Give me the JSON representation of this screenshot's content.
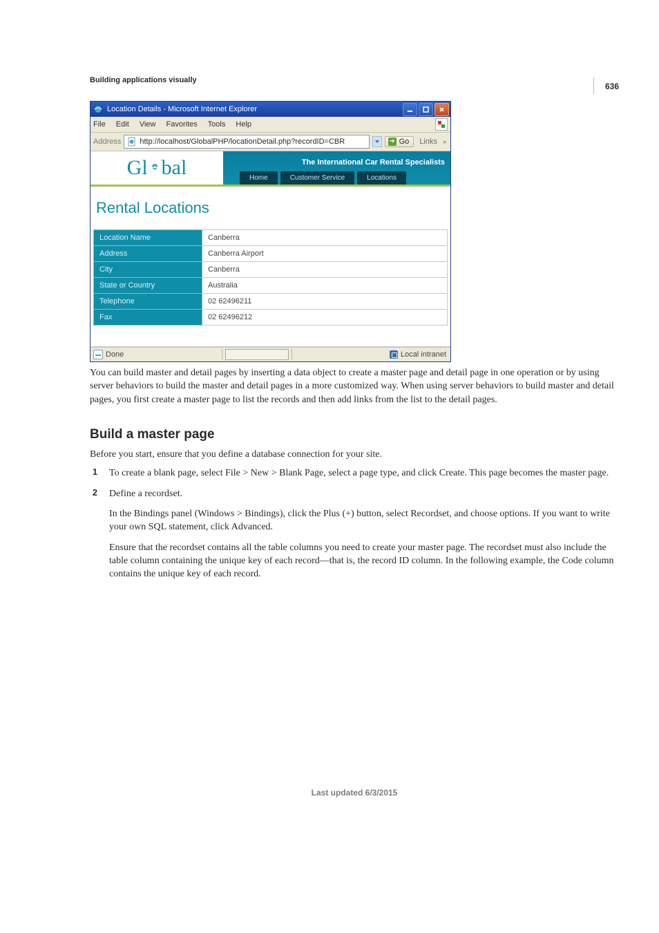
{
  "page_number": "636",
  "running_head": "Building applications visually",
  "screenshot": {
    "window_title": "Location Details - Microsoft Internet Explorer",
    "menu": [
      "File",
      "Edit",
      "View",
      "Favorites",
      "Tools",
      "Help"
    ],
    "address_label": "Address",
    "url": "http://localhost/GlobalPHP/locationDetail.php?recordID=CBR",
    "go_label": "Go",
    "links_label": "Links",
    "tagline": "The International Car Rental Specialists",
    "logo_left": "Gl",
    "logo_right": "bal",
    "tabs": [
      "Home",
      "Customer Service",
      "Locations"
    ],
    "page_heading": "Rental Locations",
    "rows": [
      {
        "label": "Location Name",
        "value": "Canberra"
      },
      {
        "label": "Address",
        "value": "Canberra Airport"
      },
      {
        "label": "City",
        "value": "Canberra"
      },
      {
        "label": "State or Country",
        "value": "Australia"
      },
      {
        "label": "Telephone",
        "value": "02 62496211"
      },
      {
        "label": "Fax",
        "value": "02 62496212"
      }
    ],
    "status_done": "Done",
    "status_zone": "Local intranet"
  },
  "caption_para": "You can build master and detail pages by inserting a data object to create a master page and detail page in one operation or by using server behaviors to build the master and detail pages in a more customized way. When using server behaviors to build master and detail pages, you first create a master page to list the records and then add links from the list to the detail pages.",
  "sect_heading": "Build a master page",
  "intro": "Before you start, ensure that you define a database connection for your site.",
  "steps": [
    {
      "text": "To create a blank page, select File > New > Blank Page, select a page type, and click Create. This page becomes the master page."
    },
    {
      "text": "Define a recordset.",
      "sub": [
        "In the Bindings panel (Windows > Bindings), click the Plus (+) button, select Recordset, and choose options. If you want to write your own SQL statement, click Advanced.",
        "Ensure that the recordset contains all the table columns you need to create your master page. The recordset must also include the table column containing the unique key of each record—that is, the record ID column. In the following example, the Code column contains the unique key of each record."
      ]
    }
  ],
  "footer": "Last updated 6/3/2015"
}
